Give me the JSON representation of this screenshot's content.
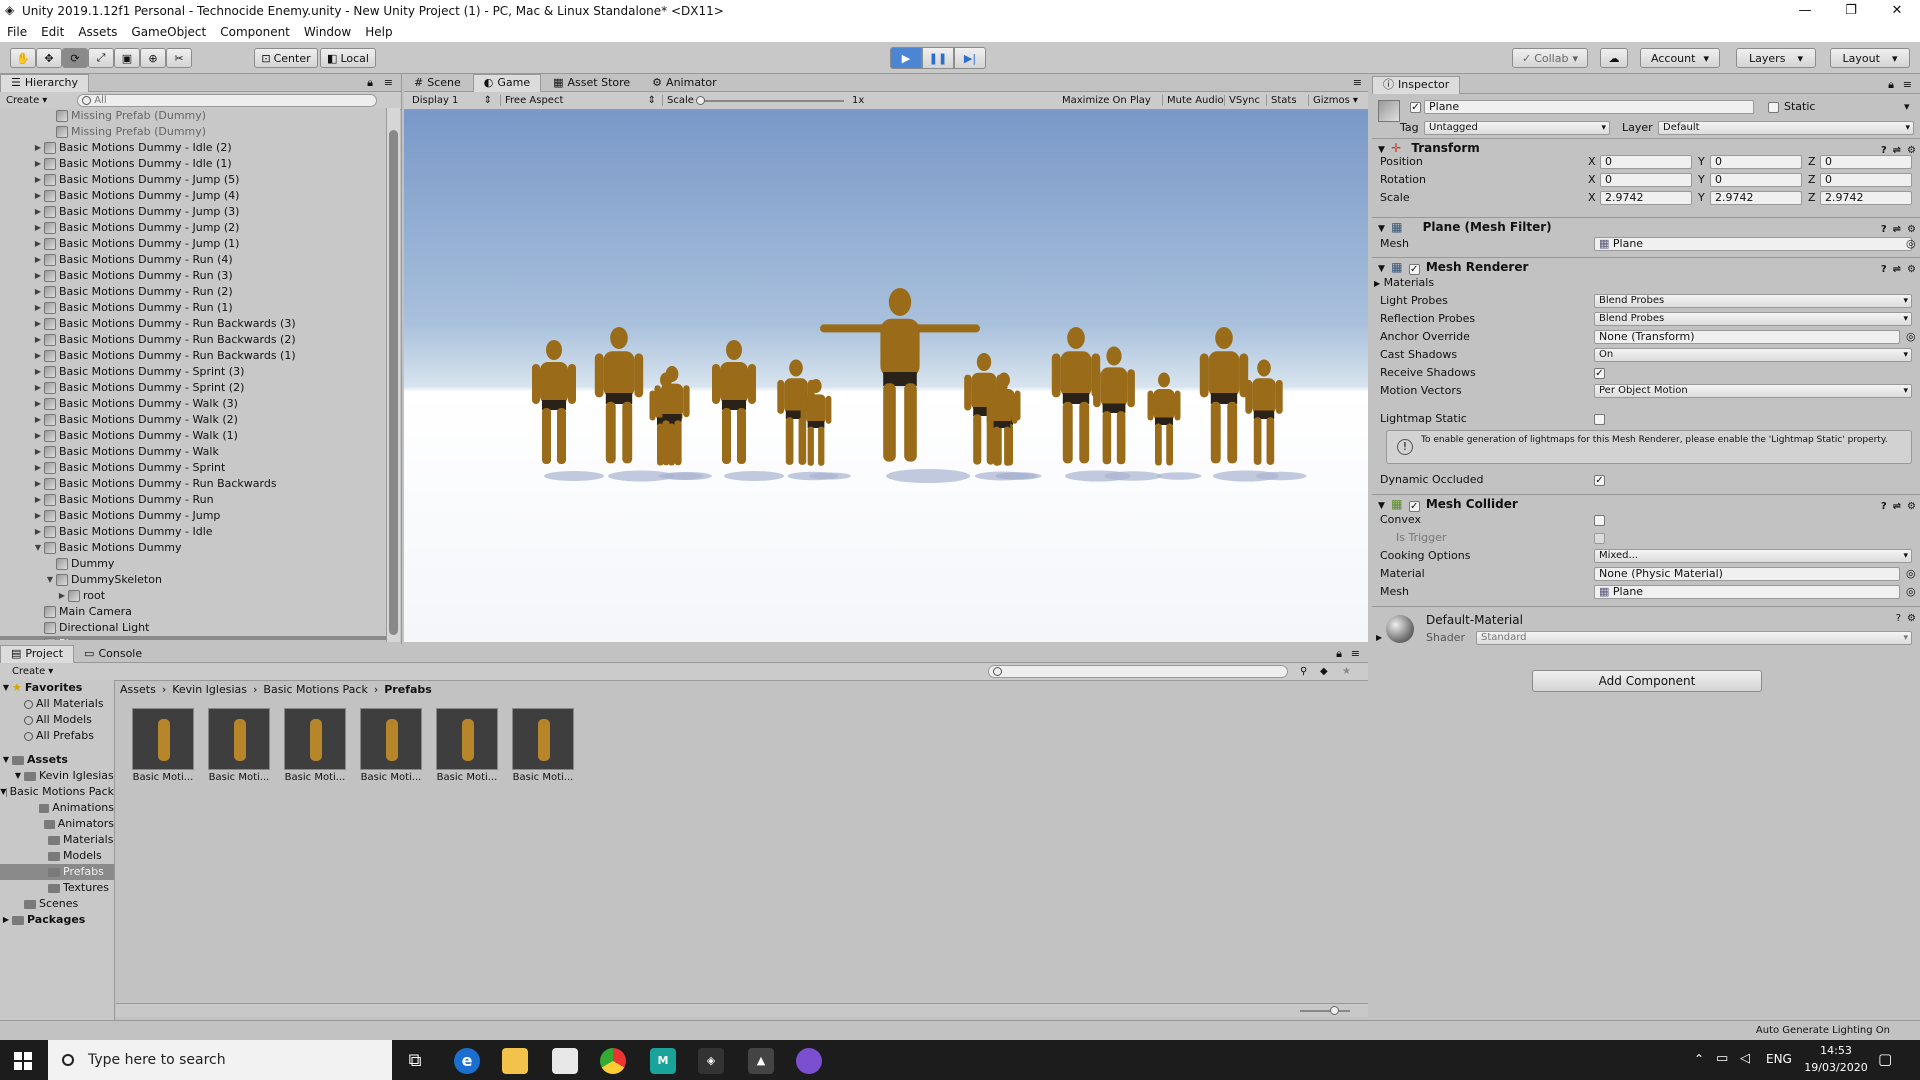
{
  "window": {
    "title": "Unity 2019.1.12f1 Personal - Technocide Enemy.unity - New Unity Project (1) - PC, Mac & Linux Standalone* <DX11>"
  },
  "menu": [
    "File",
    "Edit",
    "Assets",
    "GameObject",
    "Component",
    "Window",
    "Help"
  ],
  "toolbar": {
    "pivot": "Center",
    "space": "Local",
    "collab": "Collab",
    "account": "Account",
    "layers": "Layers",
    "layout": "Layout",
    "play_active": true
  },
  "hierarchy": {
    "tab": "Hierarchy",
    "create": "Create",
    "search_placeholder": "All",
    "items": [
      {
        "label": "Missing Prefab (Dummy)",
        "indent": 2,
        "arrow": "",
        "faded": true
      },
      {
        "label": "Missing Prefab (Dummy)",
        "indent": 2,
        "arrow": "",
        "faded": true
      },
      {
        "label": "Basic Motions Dummy - Idle (2)",
        "indent": 1,
        "arrow": "▶"
      },
      {
        "label": "Basic Motions Dummy - Idle (1)",
        "indent": 1,
        "arrow": "▶"
      },
      {
        "label": "Basic Motions Dummy - Jump (5)",
        "indent": 1,
        "arrow": "▶"
      },
      {
        "label": "Basic Motions Dummy - Jump (4)",
        "indent": 1,
        "arrow": "▶"
      },
      {
        "label": "Basic Motions Dummy - Jump (3)",
        "indent": 1,
        "arrow": "▶"
      },
      {
        "label": "Basic Motions Dummy - Jump (2)",
        "indent": 1,
        "arrow": "▶"
      },
      {
        "label": "Basic Motions Dummy - Jump (1)",
        "indent": 1,
        "arrow": "▶"
      },
      {
        "label": "Basic Motions Dummy - Run (4)",
        "indent": 1,
        "arrow": "▶"
      },
      {
        "label": "Basic Motions Dummy - Run (3)",
        "indent": 1,
        "arrow": "▶"
      },
      {
        "label": "Basic Motions Dummy - Run (2)",
        "indent": 1,
        "arrow": "▶"
      },
      {
        "label": "Basic Motions Dummy - Run (1)",
        "indent": 1,
        "arrow": "▶"
      },
      {
        "label": "Basic Motions Dummy - Run Backwards (3)",
        "indent": 1,
        "arrow": "▶"
      },
      {
        "label": "Basic Motions Dummy - Run Backwards (2)",
        "indent": 1,
        "arrow": "▶"
      },
      {
        "label": "Basic Motions Dummy - Run Backwards (1)",
        "indent": 1,
        "arrow": "▶"
      },
      {
        "label": "Basic Motions Dummy - Sprint (3)",
        "indent": 1,
        "arrow": "▶"
      },
      {
        "label": "Basic Motions Dummy - Sprint (2)",
        "indent": 1,
        "arrow": "▶"
      },
      {
        "label": "Basic Motions Dummy - Walk (3)",
        "indent": 1,
        "arrow": "▶"
      },
      {
        "label": "Basic Motions Dummy - Walk (2)",
        "indent": 1,
        "arrow": "▶"
      },
      {
        "label": "Basic Motions Dummy - Walk (1)",
        "indent": 1,
        "arrow": "▶"
      },
      {
        "label": "Basic Motions Dummy - Walk",
        "indent": 1,
        "arrow": "▶"
      },
      {
        "label": "Basic Motions Dummy - Sprint",
        "indent": 1,
        "arrow": "▶"
      },
      {
        "label": "Basic Motions Dummy - Run Backwards",
        "indent": 1,
        "arrow": "▶"
      },
      {
        "label": "Basic Motions Dummy - Run",
        "indent": 1,
        "arrow": "▶"
      },
      {
        "label": "Basic Motions Dummy - Jump",
        "indent": 1,
        "arrow": "▶"
      },
      {
        "label": "Basic Motions Dummy - Idle",
        "indent": 1,
        "arrow": "▶"
      },
      {
        "label": "Basic Motions Dummy",
        "indent": 1,
        "arrow": "▼"
      },
      {
        "label": "Dummy",
        "indent": 2,
        "arrow": ""
      },
      {
        "label": "DummySkeleton",
        "indent": 2,
        "arrow": "▼"
      },
      {
        "label": "root",
        "indent": 3,
        "arrow": "▶"
      },
      {
        "label": "Main Camera",
        "indent": 1,
        "arrow": ""
      },
      {
        "label": "Directional Light",
        "indent": 1,
        "arrow": ""
      },
      {
        "label": "Plane",
        "indent": 1,
        "arrow": "",
        "selected": true
      }
    ]
  },
  "view_tabs": {
    "scene": "Scene",
    "game": "Game",
    "asset_store": "Asset Store",
    "animator": "Animator"
  },
  "game_bar": {
    "display": "Display 1",
    "aspect": "Free Aspect",
    "scale_label": "Scale",
    "scale_value": "1x",
    "maximize": "Maximize On Play",
    "mute": "Mute Audio",
    "vsync": "VSync",
    "stats": "Stats",
    "gizmos": "Gizmos"
  },
  "inspector": {
    "tab": "Inspector",
    "object_name": "Plane",
    "static_label": "Static",
    "tag_label": "Tag",
    "tag_value": "Untagged",
    "layer_label": "Layer",
    "layer_value": "Default",
    "transform": {
      "title": "Transform",
      "position_label": "Position",
      "rotation_label": "Rotation",
      "scale_label": "Scale",
      "position": [
        "0",
        "0",
        "0"
      ],
      "rotation": [
        "0",
        "0",
        "0"
      ],
      "scale": [
        "2.9742",
        "2.9742",
        "2.9742"
      ],
      "x": "X",
      "y": "Y",
      "z": "Z"
    },
    "mesh_filter": {
      "title": "Plane (Mesh Filter)",
      "mesh_label": "Mesh",
      "mesh_value": "Plane"
    },
    "mesh_renderer": {
      "title": "Mesh Renderer",
      "materials": "Materials",
      "light_probes_label": "Light Probes",
      "light_probes": "Blend Probes",
      "reflection_probes_label": "Reflection Probes",
      "reflection_probes": "Blend Probes",
      "anchor_override_label": "Anchor Override",
      "anchor_override": "None (Transform)",
      "cast_shadows_label": "Cast Shadows",
      "cast_shadows": "On",
      "receive_shadows_label": "Receive Shadows",
      "motion_vectors_label": "Motion Vectors",
      "motion_vectors": "Per Object Motion",
      "lightmap_static_label": "Lightmap Static",
      "info": "To enable generation of lightmaps for this Mesh Renderer, please enable the 'Lightmap Static' property.",
      "dynamic_occluded_label": "Dynamic Occluded"
    },
    "mesh_collider": {
      "title": "Mesh Collider",
      "convex_label": "Convex",
      "is_trigger_label": "Is Trigger",
      "cooking_label": "Cooking Options",
      "cooking": "Mixed...",
      "material_label": "Material",
      "material": "None (Physic Material)",
      "mesh_label": "Mesh",
      "mesh": "Plane"
    },
    "material": {
      "name": "Default-Material",
      "shader_label": "Shader",
      "shader": "Standard"
    },
    "add_component": "Add Component"
  },
  "project": {
    "tab_project": "Project",
    "tab_console": "Console",
    "create": "Create",
    "breadcrumb": [
      "Assets",
      "Kevin Iglesias",
      "Basic Motions Pack",
      "Prefabs"
    ],
    "favorites_label": "Favorites",
    "favorites": [
      "All Materials",
      "All Models",
      "All Prefabs"
    ],
    "assets_label": "Assets",
    "tree": [
      {
        "label": "Kevin Iglesias",
        "indent": 1,
        "arrow": "▼"
      },
      {
        "label": "Basic Motions Pack",
        "indent": 2,
        "arrow": "▼"
      },
      {
        "label": "Animations",
        "indent": 3,
        "arrow": ""
      },
      {
        "label": "Animators",
        "indent": 3,
        "arrow": ""
      },
      {
        "label": "Materials",
        "indent": 3,
        "arrow": ""
      },
      {
        "label": "Models",
        "indent": 3,
        "arrow": ""
      },
      {
        "label": "Prefabs",
        "indent": 3,
        "arrow": "",
        "selected": true
      },
      {
        "label": "Textures",
        "indent": 3,
        "arrow": ""
      },
      {
        "label": "Scenes",
        "indent": 1,
        "arrow": ""
      }
    ],
    "packages_label": "Packages",
    "asset_items": [
      "Basic Moti...",
      "Basic Moti...",
      "Basic Moti...",
      "Basic Moti...",
      "Basic Moti...",
      "Basic Moti..."
    ]
  },
  "status": {
    "auto_lighting": "Auto Generate Lighting On"
  },
  "taskbar": {
    "search_placeholder": "Type here to search",
    "language": "ENG",
    "time": "14:53",
    "date": "19/03/2020"
  }
}
